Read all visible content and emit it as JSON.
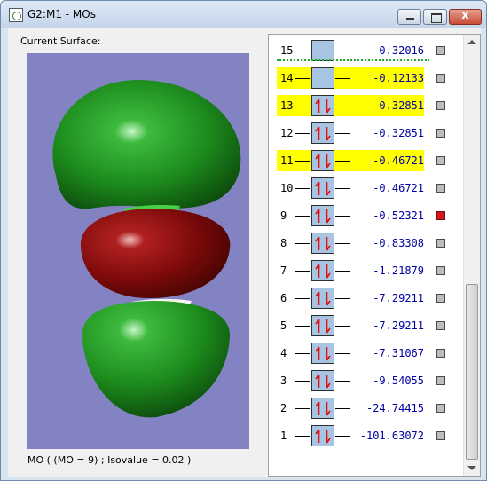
{
  "window": {
    "title": "G2:M1 - MOs",
    "close_glyph": "x"
  },
  "left": {
    "current_surface_label": "Current Surface:",
    "caption": "MO ( (MO = 9) ; Isovalue = 0.02 )"
  },
  "colors": {
    "surface_background": "#8383c3",
    "positive_lobe": "#1f8a1f",
    "negative_lobe": "#8a0a0a",
    "mo_box": "#a7c4e2",
    "highlight": "#ffff00",
    "energy_text": "#0000a0",
    "active_marker": "#d4161a"
  },
  "orbitals": [
    {
      "num": "15",
      "energy": "0.32016",
      "occupied": false,
      "highlight": false,
      "active": false
    },
    {
      "num": "14",
      "energy": "-0.12133",
      "occupied": false,
      "highlight": true,
      "active": false
    },
    {
      "num": "13",
      "energy": "-0.32851",
      "occupied": true,
      "highlight": true,
      "active": false
    },
    {
      "num": "12",
      "energy": "-0.32851",
      "occupied": true,
      "highlight": false,
      "active": false
    },
    {
      "num": "11",
      "energy": "-0.46721",
      "occupied": true,
      "highlight": true,
      "active": false
    },
    {
      "num": "10",
      "energy": "-0.46721",
      "occupied": true,
      "highlight": false,
      "active": false
    },
    {
      "num": "9",
      "energy": "-0.52321",
      "occupied": true,
      "highlight": false,
      "active": true
    },
    {
      "num": "8",
      "energy": "-0.83308",
      "occupied": true,
      "highlight": false,
      "active": false
    },
    {
      "num": "7",
      "energy": "-1.21879",
      "occupied": true,
      "highlight": false,
      "active": false
    },
    {
      "num": "6",
      "energy": "-7.29211",
      "occupied": true,
      "highlight": false,
      "active": false
    },
    {
      "num": "5",
      "energy": "-7.29211",
      "occupied": true,
      "highlight": false,
      "active": false
    },
    {
      "num": "4",
      "energy": "-7.31067",
      "occupied": true,
      "highlight": false,
      "active": false
    },
    {
      "num": "3",
      "energy": "-9.54055",
      "occupied": true,
      "highlight": false,
      "active": false
    },
    {
      "num": "2",
      "energy": "-24.74415",
      "occupied": true,
      "highlight": false,
      "active": false
    },
    {
      "num": "1",
      "energy": "-101.63072",
      "occupied": true,
      "highlight": false,
      "active": false
    }
  ]
}
